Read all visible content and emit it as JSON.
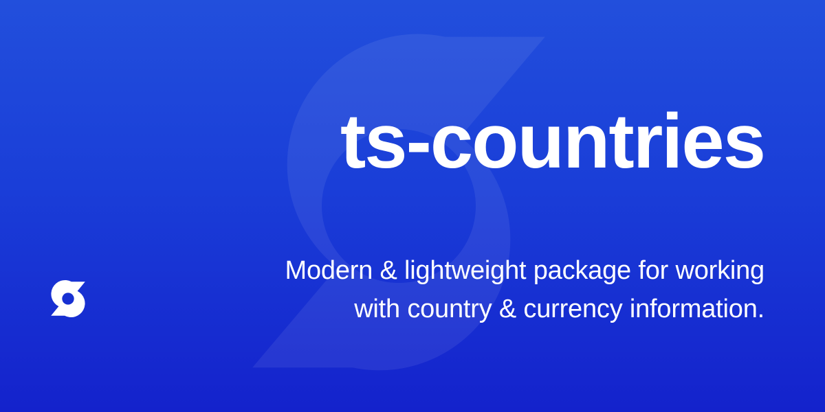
{
  "banner": {
    "title": "ts-countries",
    "tagline_line1": "Modern & lightweight package for working",
    "tagline_line2": "with country & currency information.",
    "logo_icon": "ts-countries-logo-icon",
    "background_mark": "ts-countries-logo-watermark"
  },
  "colors": {
    "background_top": "#224fdc",
    "background_bottom": "#1422cc",
    "text": "#ffffff"
  }
}
